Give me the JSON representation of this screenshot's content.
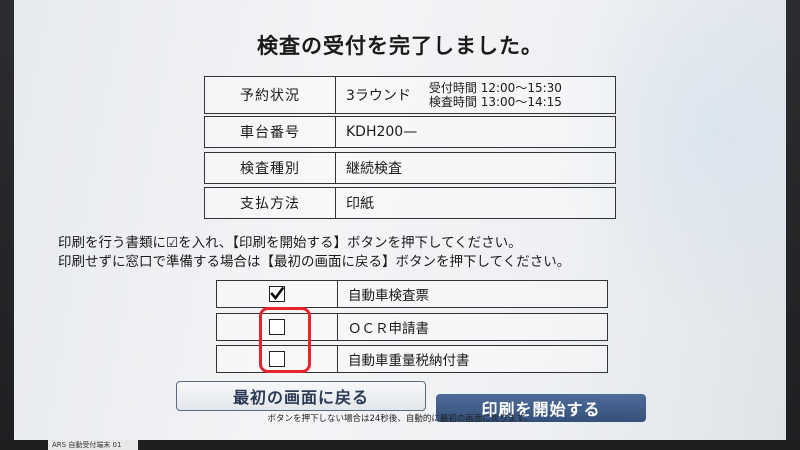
{
  "title": "検査の受付を完了しました。",
  "info": {
    "reservation_label": "予約状況",
    "reservation_value": "3ラウンド",
    "reception_time": "受付時間 12:00～15:30",
    "inspection_time": "検査時間 13:00～14:15",
    "vehicle_label": "車台番号",
    "vehicle_value": "KDH200—",
    "type_label": "検査種別",
    "type_value": "継続検査",
    "payment_label": "支払方法",
    "payment_value": "印紙"
  },
  "instructions": {
    "line1": "印刷を行う書類に☑を入れ、【印刷を開始する】ボタンを押下してください。",
    "line2": "印刷せずに窓口で準備する場合は【最初の画面に戻る】ボタンを押下してください。"
  },
  "documents": [
    {
      "label": "自動車検査票",
      "checked": true
    },
    {
      "label": "ＯＣＲ申請書",
      "checked": false
    },
    {
      "label": "自動車重量税納付書",
      "checked": false
    }
  ],
  "buttons": {
    "back_label": "最初の画面に戻る",
    "start_label": "印刷を開始する"
  },
  "footnote": "ボタンを押下しない場合は24秒後、自動的に最初の画面に戻ります。",
  "sticker": "ARS 自動受付端末 01",
  "colors": {
    "primary_button": "#34507a",
    "highlight": "#e8242b"
  }
}
